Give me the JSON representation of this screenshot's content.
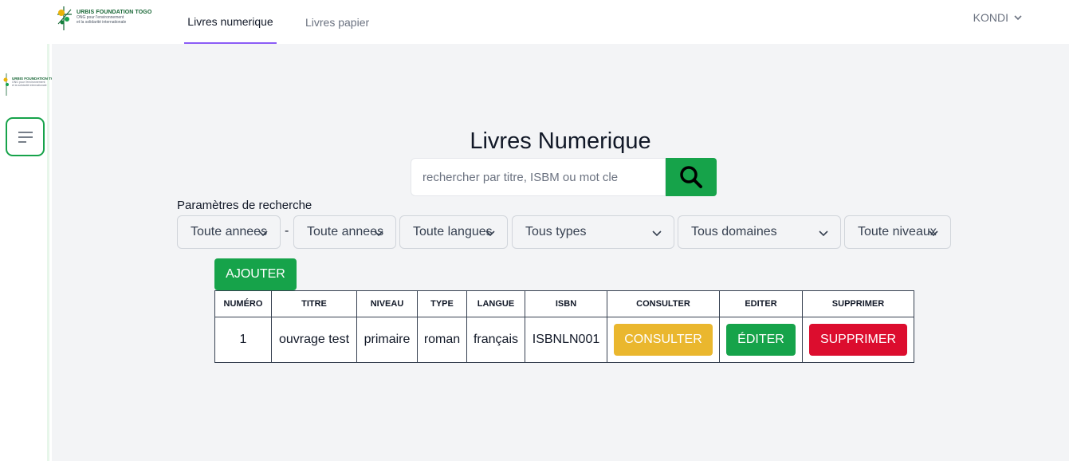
{
  "brand": {
    "name": "URBIS FOUNDATION TOGO",
    "tagline_1": "ONG pour l'environnement",
    "tagline_2": "et la solidarité internationale"
  },
  "nav": {
    "tabs": [
      {
        "label": "Livres numerique",
        "active": true
      },
      {
        "label": "Livres papier",
        "active": false
      }
    ],
    "user": "KONDI"
  },
  "sidebar": {
    "logo_name": "URBIS FOUNDATION TOGO",
    "logo_tag_1": "ONG pour l'environnement",
    "logo_tag_2": "et la solidarité internationale",
    "menu_icon": "hamburger-icon"
  },
  "main": {
    "title": "Livres Numerique",
    "search": {
      "placeholder": "rechercher par titre, ISBM ou mot cle",
      "value": ""
    },
    "params_label": "Paramètres de recherche",
    "filters": {
      "annee_debut": "Toute annees",
      "separator": "-",
      "annee_fin": "Toute annees",
      "langues": "Toute langues",
      "types": "Tous types",
      "domaines": "Tous domaines",
      "niveaux": "Toute niveaux"
    },
    "add_label": "AJOUTER",
    "table": {
      "headers": [
        "NUMÉRO",
        "TITRE",
        "NIVEAU",
        "TYPE",
        "LANGUE",
        "ISBN",
        "CONSULTER",
        "EDITER",
        "SUPPRIMER"
      ],
      "rows": [
        {
          "numero": "1",
          "titre": "ouvrage test",
          "niveau": "primaire",
          "type": "roman",
          "langue": "français",
          "isbn": "ISBNLN001",
          "consulter": "CONSULTER",
          "editer": "ÉDITER",
          "supprimer": "SUPPRIMER"
        }
      ]
    }
  },
  "colors": {
    "accent_green": "#16a34a",
    "tab_underline": "#8b5cf6",
    "consult_yellow": "#eab72e",
    "delete_red": "#dc0d2e",
    "background": "#f3f4f6"
  }
}
